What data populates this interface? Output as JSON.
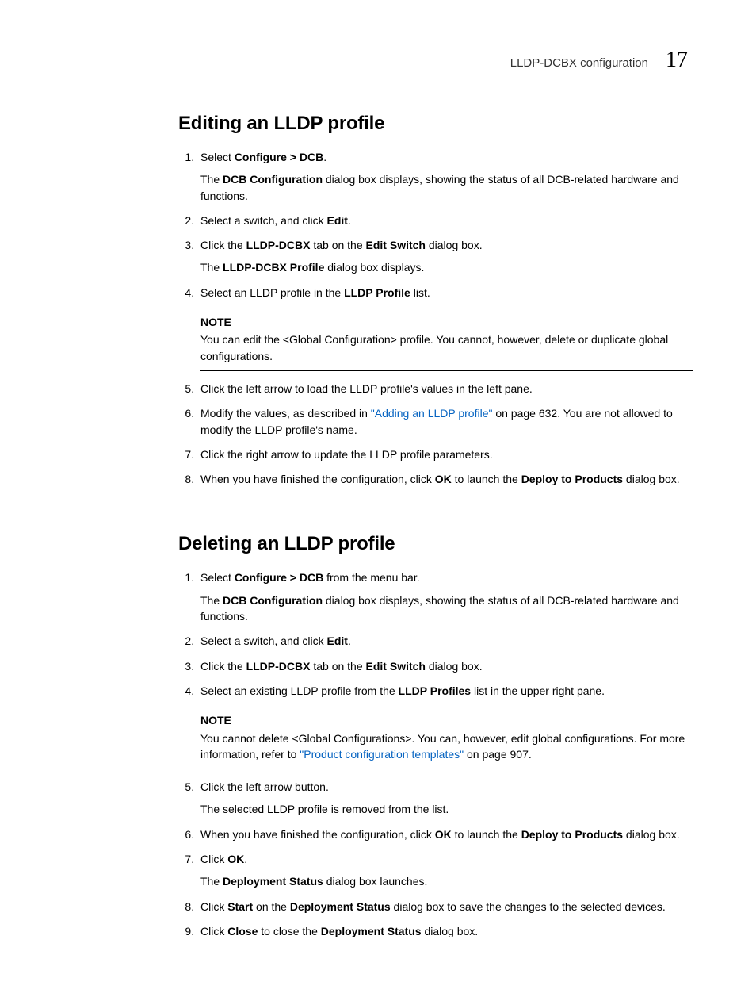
{
  "header": {
    "breadcrumb": "LLDP-DCBX configuration",
    "chapter_number": "17"
  },
  "section1": {
    "title": "Editing an LLDP profile",
    "steps": {
      "s1": {
        "lead": "Select ",
        "bold": "Configure > DCB",
        "tail": ".",
        "sub_lead": "The ",
        "sub_bold": "DCB Configuration",
        "sub_tail": " dialog box displays, showing the status of all DCB-related hardware and functions."
      },
      "s2": {
        "lead": "Select a switch, and click ",
        "bold": "Edit",
        "tail": "."
      },
      "s3": {
        "lead": "Click the ",
        "bold1": "LLDP-DCBX",
        "mid1": " tab on the ",
        "bold2": "Edit Switch",
        "tail": " dialog box.",
        "sub_lead": "The ",
        "sub_bold": "LLDP-DCBX Profile",
        "sub_tail": " dialog box displays."
      },
      "s4": {
        "lead": "Select an LLDP profile in the ",
        "bold": "LLDP Profile",
        "tail": " list.",
        "note_label": "NOTE",
        "note_text": "You can edit the <Global Configuration> profile. You cannot, however, delete or duplicate global configurations."
      },
      "s5": {
        "text": "Click the left arrow to load the LLDP profile's values in the left pane."
      },
      "s6": {
        "lead": "Modify the values, as described in ",
        "link": "\"Adding an LLDP profile\"",
        "tail": " on page 632. You are not allowed to modify the LLDP profile's name."
      },
      "s7": {
        "text": "Click the right arrow to update the LLDP profile parameters."
      },
      "s8": {
        "lead": "When you have finished the configuration, click ",
        "bold1": "OK",
        "mid1": " to launch the ",
        "bold2": "Deploy to Products",
        "tail": " dialog box."
      }
    }
  },
  "section2": {
    "title": "Deleting an LLDP profile",
    "steps": {
      "s1": {
        "lead": "Select ",
        "bold": "Configure > DCB",
        "tail": " from the menu bar.",
        "sub_lead": "The ",
        "sub_bold": "DCB Configuration",
        "sub_tail": " dialog box displays, showing the status of all DCB-related hardware and functions."
      },
      "s2": {
        "lead": "Select a switch, and click ",
        "bold": "Edit",
        "tail": "."
      },
      "s3": {
        "lead": "Click the ",
        "bold1": "LLDP-DCBX",
        "mid1": " tab on the ",
        "bold2": "Edit Switch",
        "tail": " dialog box."
      },
      "s4": {
        "lead": "Select an existing LLDP profile from the ",
        "bold": "LLDP Profiles",
        "tail": " list in the upper right pane.",
        "note_label": "NOTE",
        "note_lead": "You cannot delete <Global Configurations>. You can, however, edit global configurations. For more information, refer to ",
        "note_link": "\"Product configuration templates\"",
        "note_tail": " on page 907."
      },
      "s5": {
        "text": "Click the left arrow button.",
        "sub": "The selected LLDP profile is removed from the list."
      },
      "s6": {
        "lead": "When you have finished the configuration, click ",
        "bold1": "OK",
        "mid1": " to launch the ",
        "bold2": "Deploy to Products",
        "tail": " dialog box."
      },
      "s7": {
        "lead": "Click ",
        "bold": "OK",
        "tail": ".",
        "sub_lead": "The ",
        "sub_bold": "Deployment Status",
        "sub_tail": " dialog box launches."
      },
      "s8": {
        "lead": "Click ",
        "bold1": "Start",
        "mid1": " on the ",
        "bold2": "Deployment Status",
        "tail": " dialog box to save the changes to the selected devices."
      },
      "s9": {
        "lead": "Click ",
        "bold1": "Close",
        "mid1": " to close the ",
        "bold2": "Deployment Status",
        "tail": " dialog box."
      }
    }
  }
}
